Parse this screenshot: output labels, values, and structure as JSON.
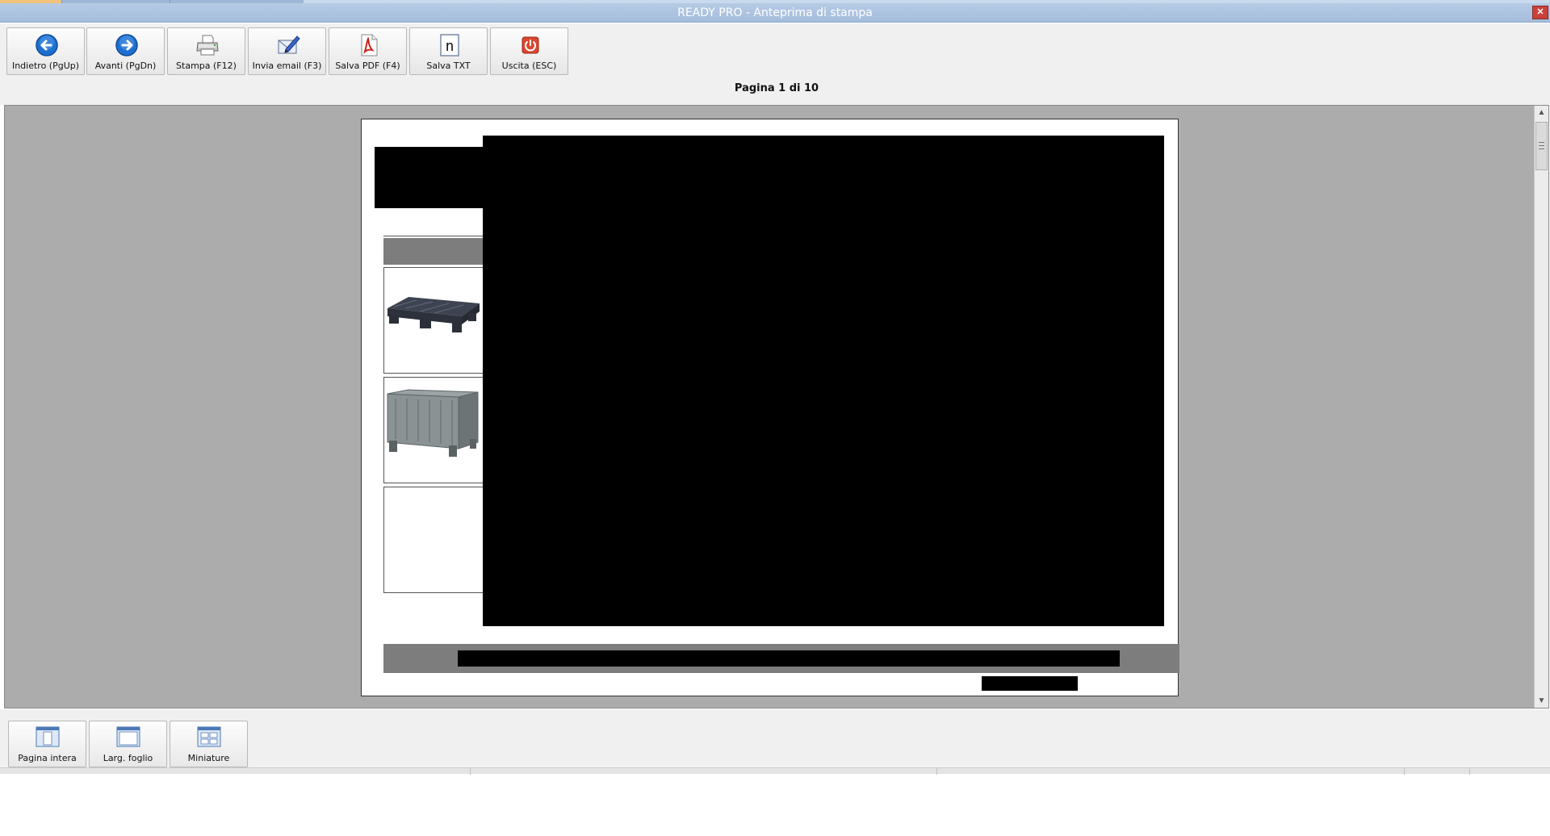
{
  "window": {
    "title": "READY PRO - Anteprima di stampa"
  },
  "toolbar": {
    "buttons": [
      {
        "label": "Indietro (PgUp)",
        "icon": "back-arrow-icon"
      },
      {
        "label": "Avanti (PgDn)",
        "icon": "forward-arrow-icon"
      },
      {
        "label": "Stampa (F12)",
        "icon": "printer-icon"
      },
      {
        "label": "Invia email (F3)",
        "icon": "email-pen-icon"
      },
      {
        "label": "Salva PDF (F4)",
        "icon": "pdf-icon"
      },
      {
        "label": "Salva TXT",
        "icon": "txt-icon"
      },
      {
        "label": "Uscita (ESC)",
        "icon": "power-icon"
      }
    ],
    "txt_glyph": "n"
  },
  "pager": {
    "text": "Pagina 1 di 10"
  },
  "view_buttons": [
    {
      "label": "Pagina intera",
      "icon": "full-page-icon"
    },
    {
      "label": "Larg. foglio",
      "icon": "page-width-icon"
    },
    {
      "label": "Miniature",
      "icon": "thumbnails-icon"
    }
  ],
  "colors": {
    "accent_blue": "#1f6fd0",
    "title_bar": "#a4bcdc",
    "exit_red": "#d9472f",
    "preview_bg": "#acacac"
  }
}
